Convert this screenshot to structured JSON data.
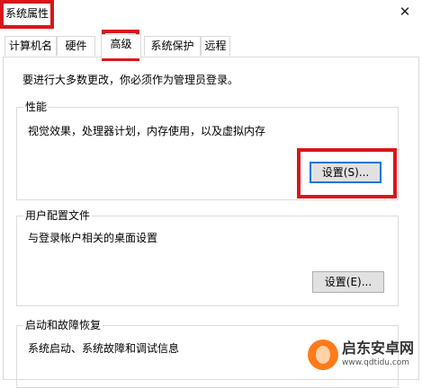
{
  "window": {
    "title": "系统属性",
    "close_glyph": "✕"
  },
  "tabs": [
    {
      "label": "计算机名",
      "active": false
    },
    {
      "label": "硬件",
      "active": false
    },
    {
      "label": "高级",
      "active": true
    },
    {
      "label": "系统保护",
      "active": false
    },
    {
      "label": "远程",
      "active": false
    }
  ],
  "admin_note": "要进行大多数更改，你必须作为管理员登录。",
  "performance": {
    "title": "性能",
    "description": "视觉效果，处理器计划，内存使用，以及虚拟内存",
    "button_label": "设置(S)..."
  },
  "user_profiles": {
    "title": "用户配置文件",
    "description": "与登录帐户相关的桌面设置",
    "button_label": "设置(E)..."
  },
  "startup_recovery": {
    "title": "启动和故障恢复",
    "description": "系统启动、系统故障和调试信息"
  },
  "watermark": {
    "name": "启东安卓网",
    "url": "www.qdtidu.com"
  },
  "colors": {
    "highlight_red": "#d9161c",
    "focus_blue": "#0078d7",
    "button_face": "#e1e1e1"
  }
}
